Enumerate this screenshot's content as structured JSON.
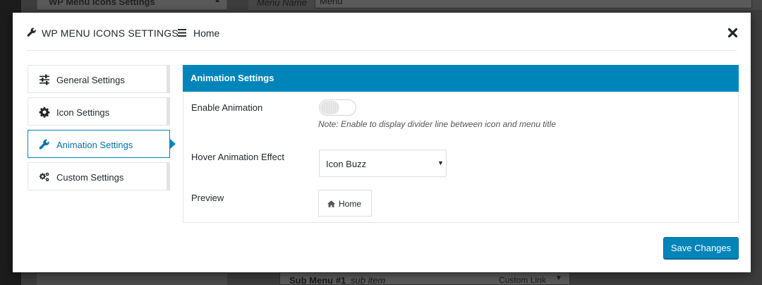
{
  "background": {
    "top_left_box_title": "WP Menu Icons Settings",
    "menu_name_label": "Menu Name",
    "menu_name_value": "Menu",
    "sub_item_title": "Sub Menu #1",
    "sub_item_subtitle": "sub item",
    "sub_item_type": "Custom Link"
  },
  "modal": {
    "header": {
      "title": "WP MENU ICONS SETTINGS",
      "breadcrumb": "Home"
    },
    "sidebar": {
      "items": [
        {
          "label": "General Settings",
          "icon": "sliders-icon"
        },
        {
          "label": "Icon Settings",
          "icon": "gear-icon"
        },
        {
          "label": "Animation Settings",
          "icon": "wrench-icon",
          "active": true
        },
        {
          "label": "Custom Settings",
          "icon": "gears-icon"
        }
      ]
    },
    "panel": {
      "heading": "Animation Settings",
      "enable_animation_label": "Enable Animation",
      "enable_animation_on": false,
      "note": "Note: Enable to display divider line between icon and menu title",
      "hover_effect_label": "Hover Animation Effect",
      "hover_effect_value": "Icon Buzz",
      "preview_label": "Preview",
      "preview_text": "Home"
    },
    "save_label": "Save Changes"
  },
  "colors": {
    "accent": "#0085ba",
    "accent_text": "#0073aa"
  }
}
